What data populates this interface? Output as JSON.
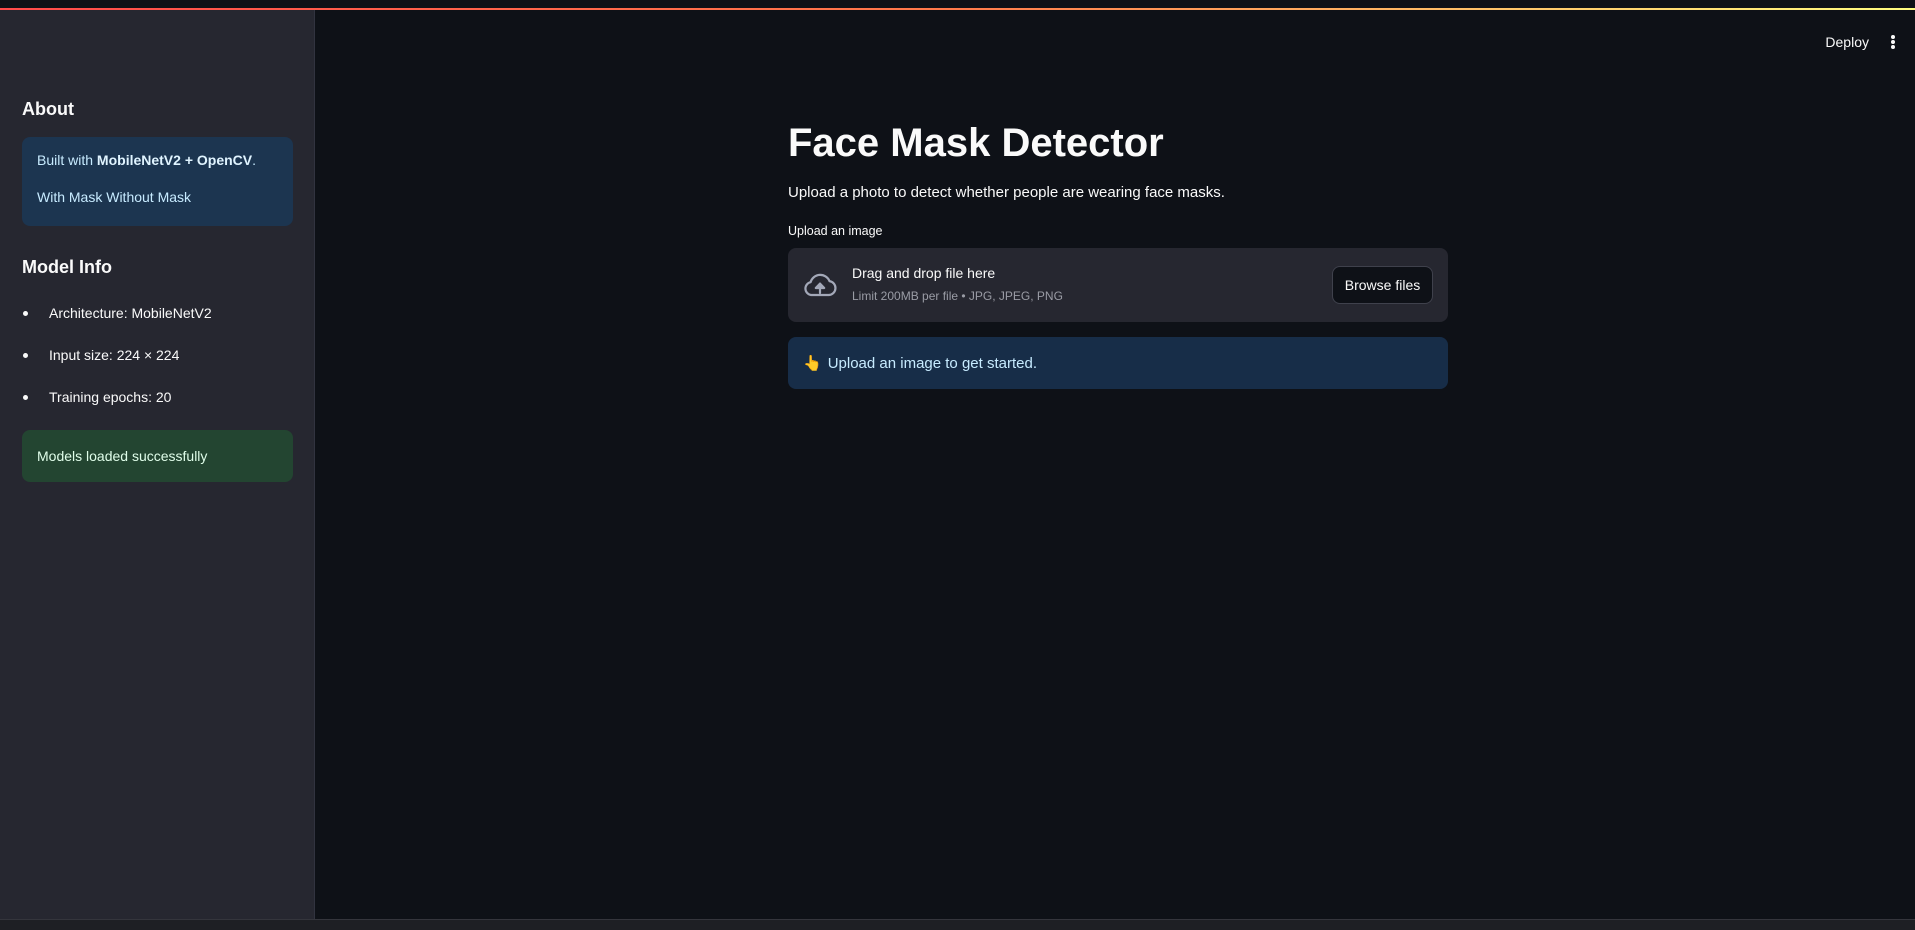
{
  "colors": {
    "background": "#0e1117",
    "sidebar": "#262730",
    "info": "#1c3550",
    "success": "#234531",
    "accent_stripe": "#ff4b4b"
  },
  "header": {
    "deploy_label": "Deploy",
    "menu_icon": "more-vertical-icon"
  },
  "sidebar": {
    "about_title": "About",
    "about_box": {
      "line1_prefix": "Built with ",
      "line1_bold1": "MobileNetV2",
      "line1_plus": " + ",
      "line1_bold2": "OpenCV",
      "line1_suffix": ".",
      "line2": "With Mask Without Mask"
    },
    "model_title": "Model Info",
    "model_items": [
      "Architecture: MobileNetV2",
      "Input size: 224 × 224",
      "Training epochs: 20"
    ],
    "status_message": "Models loaded successfully"
  },
  "main": {
    "title": "Face Mask Detector",
    "subtitle": "Upload a photo to detect whether people are wearing face masks.",
    "upload": {
      "label": "Upload an image",
      "icon": "cloud-upload-icon",
      "drop_text": "Drag and drop file here",
      "limit_text": "Limit 200MB per file • JPG, JPEG, PNG",
      "browse_label": "Browse files"
    },
    "info_banner": {
      "emoji": "👆",
      "text": "Upload an image to get started."
    }
  }
}
